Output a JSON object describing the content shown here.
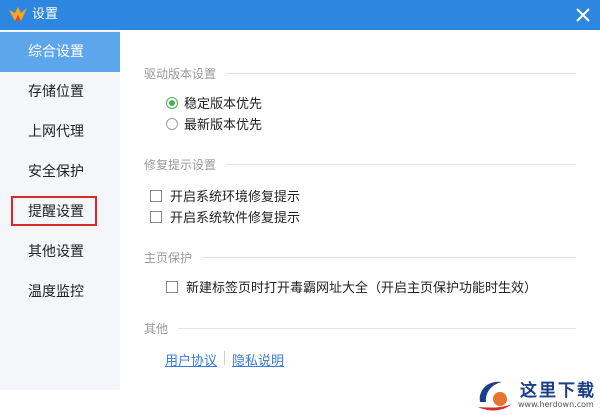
{
  "window": {
    "title": "设置",
    "brand_color": "#2d87e0",
    "close_icon": "close-icon"
  },
  "sidebar": {
    "items": [
      {
        "label": "综合设置",
        "active": true
      },
      {
        "label": "存储位置"
      },
      {
        "label": "上网代理"
      },
      {
        "label": "安全保护"
      },
      {
        "label": "提醒设置",
        "highlighted": true
      },
      {
        "label": "其他设置"
      },
      {
        "label": "温度监控"
      }
    ]
  },
  "sections": {
    "driver": {
      "title": "驱动版本设置",
      "options": [
        {
          "label": "稳定版本优先",
          "checked": true
        },
        {
          "label": "最新版本优先",
          "checked": false
        }
      ]
    },
    "repair": {
      "title": "修复提示设置",
      "options": [
        {
          "label": "开启系统环境修复提示",
          "checked": false
        },
        {
          "label": "开启系统软件修复提示",
          "checked": false
        }
      ]
    },
    "homepage": {
      "title": "主页保护",
      "options": [
        {
          "label": "新建标签页时打开毒霸网址大全（开启主页保护功能时生效）",
          "checked": false
        }
      ]
    },
    "other": {
      "title": "其他",
      "links": [
        {
          "label": "用户协议"
        },
        {
          "label": "隐私说明"
        }
      ]
    }
  },
  "watermark": {
    "title": "这里下载",
    "url": "www.herdown.com"
  }
}
